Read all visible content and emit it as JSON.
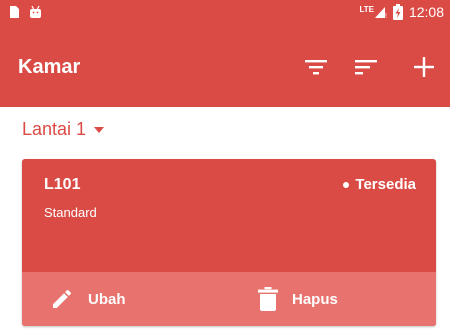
{
  "colors": {
    "primary": "#db4b45",
    "action_bar": "#e8726d"
  },
  "status_bar": {
    "time": "12:08",
    "network": "LTE",
    "icons": [
      "sim-card-icon",
      "android-icon",
      "signal-icon",
      "battery-charging-icon"
    ]
  },
  "app_bar": {
    "title": "Kamar",
    "actions": [
      "filter-icon",
      "sort-icon",
      "add-icon"
    ]
  },
  "floor_selector": {
    "value": "Lantai 1"
  },
  "room_card": {
    "code": "L101",
    "type": "Standard",
    "status": "Tersedia",
    "edit_label": "Ubah",
    "delete_label": "Hapus"
  }
}
